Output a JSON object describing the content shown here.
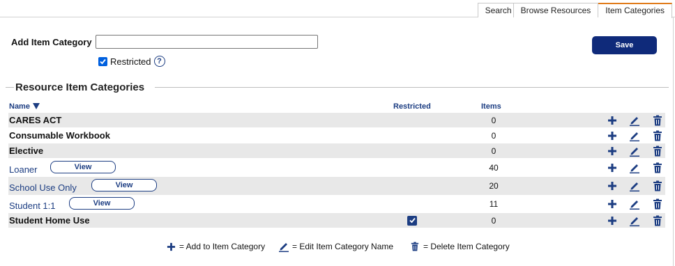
{
  "tabs": [
    {
      "label": "Search"
    },
    {
      "label": "Browse Resources"
    },
    {
      "label": "Item Categories",
      "active": true
    }
  ],
  "form": {
    "add_label": "Add Item Category",
    "add_value": "",
    "restricted_label": "Restricted",
    "restricted_checked": true,
    "help_glyph": "?",
    "save_label": "Save"
  },
  "section": {
    "title": "Resource Item Categories",
    "col_name": "Name",
    "col_restricted": "Restricted",
    "col_items": "Items"
  },
  "view_label": "View",
  "rows": [
    {
      "name": "CARES ACT",
      "items": "0",
      "restricted": false,
      "link": false
    },
    {
      "name": "Consumable Workbook",
      "items": "0",
      "restricted": false,
      "link": false
    },
    {
      "name": "Elective",
      "items": "0",
      "restricted": false,
      "link": false
    },
    {
      "name": "Loaner",
      "items": "40",
      "restricted": false,
      "link": true
    },
    {
      "name": "School Use Only",
      "items": "20",
      "restricted": false,
      "link": true
    },
    {
      "name": "Student 1:1",
      "items": "11",
      "restricted": false,
      "link": true
    },
    {
      "name": "Student Home Use",
      "items": "0",
      "restricted": true,
      "link": false
    }
  ],
  "legend": {
    "add": "= Add to Item Category",
    "edit": "= Edit Item Category Name",
    "delete": "= Delete Item Category"
  },
  "colors": {
    "primary": "#1c3d82",
    "save_bg": "#0f2a7a",
    "tab_active": "#e07b1a",
    "row_shade": "#e8e8e8"
  },
  "icons": [
    "plus-icon",
    "pencil-icon",
    "trash-icon",
    "help-icon",
    "sort-desc-icon",
    "checkbox-icon"
  ]
}
